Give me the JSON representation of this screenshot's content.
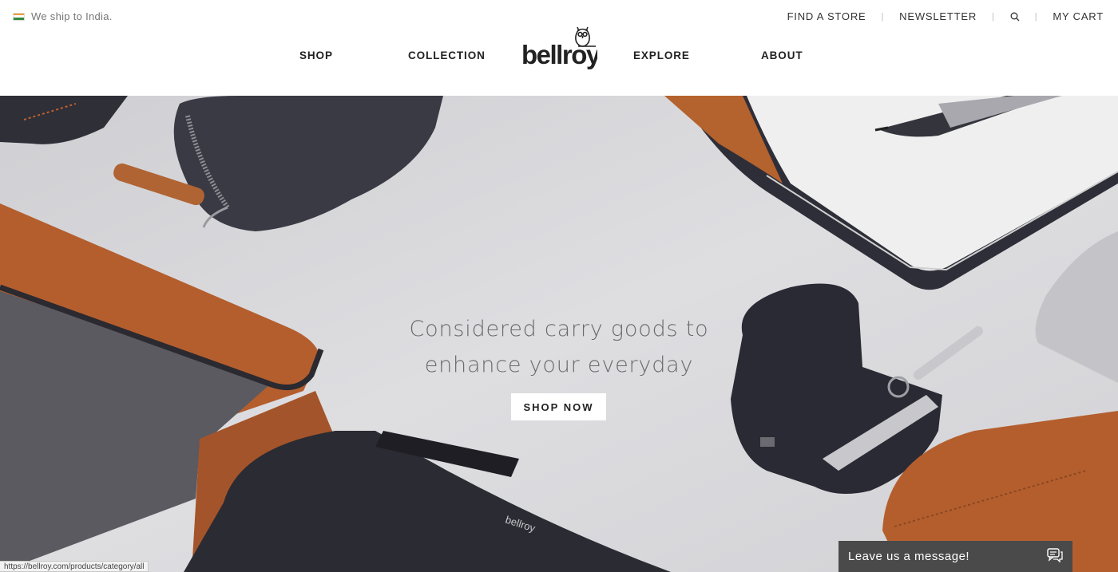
{
  "topbar": {
    "ship_text": "We ship to India.",
    "utility_links": [
      "FIND A STORE",
      "NEWSLETTER",
      "MY CART"
    ],
    "search_icon": "search-icon"
  },
  "nav": {
    "left": [
      "SHOP",
      "COLLECTION"
    ],
    "right": [
      "EXPLORE",
      "ABOUT"
    ],
    "logo_text": "bellroy"
  },
  "hero": {
    "tagline_line1": "Considered carry goods to",
    "tagline_line2": "enhance your everyday",
    "cta_label": "SHOP NOW",
    "product_brand_text": "bellroy"
  },
  "status_url": "https://bellroy.com/products/category/all",
  "chat": {
    "label": "Leave us a message!",
    "icon": "chat-bubbles-icon"
  },
  "colors": {
    "tan_leather": "#b05a2a",
    "charcoal": "#2e2e38",
    "hero_bg": "#d8d8db",
    "flag_saffron": "#f39a3b",
    "flag_green": "#2f8a3b"
  }
}
